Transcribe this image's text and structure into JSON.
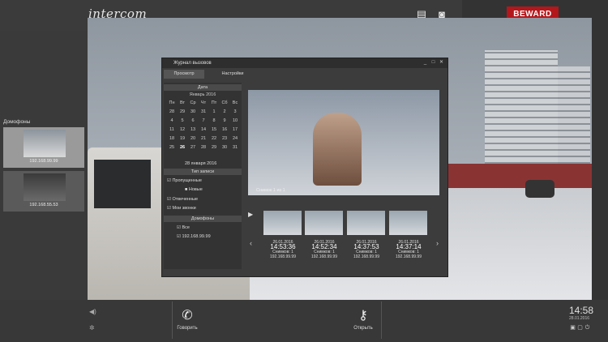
{
  "app": {
    "logo": "intercom",
    "brand": "BEWARD"
  },
  "sidebar": {
    "title": "Домофоны",
    "cameras": [
      {
        "ip": "192.168.99.99"
      },
      {
        "ip": "192.168.55.53"
      }
    ]
  },
  "dialog": {
    "title": "Журнал вызовов",
    "tabs": [
      "Просмотр",
      "Настройки"
    ],
    "date_header": "Дата",
    "month": "Январь 2016",
    "weekdays": [
      "Пн",
      "Вт",
      "Ср",
      "Чт",
      "Пт",
      "Сб",
      "Вс"
    ],
    "days": [
      [
        "28",
        "29",
        "30",
        "31",
        "1",
        "2",
        "3"
      ],
      [
        "4",
        "5",
        "6",
        "7",
        "8",
        "9",
        "10"
      ],
      [
        "11",
        "12",
        "13",
        "14",
        "15",
        "16",
        "17"
      ],
      [
        "18",
        "19",
        "20",
        "21",
        "22",
        "23",
        "24"
      ],
      [
        "25",
        "26",
        "27",
        "28",
        "29",
        "30",
        "31"
      ]
    ],
    "selected_date": "28 января 2016",
    "type_header": "Тип записи",
    "types": [
      "Пропущенные",
      "Новые",
      "Отвеченные",
      "Мои звонки"
    ],
    "intercom_header": "Домофоны",
    "intercoms": [
      "Все",
      "192.168.99.99"
    ],
    "preview_label": "Снимок 1 из 1",
    "snapshots": [
      {
        "date": "26.01.2016",
        "time": "14:53:36",
        "count": "Снимков: 1",
        "ip": "192.168.99.99"
      },
      {
        "date": "26.01.2016",
        "time": "14:52:34",
        "count": "Снимков: 1",
        "ip": "192.168.99.99"
      },
      {
        "date": "26.01.2016",
        "time": "14:37:53",
        "count": "Снимков: 1",
        "ip": "192.168.99.99"
      },
      {
        "date": "26.01.2016",
        "time": "14:37:14",
        "count": "Снимков: 1",
        "ip": "192.168.99.99"
      }
    ]
  },
  "controls": {
    "talk": "Говорить",
    "open": "Открыть"
  },
  "clock": {
    "time": "14:58",
    "date": "28.01.2016"
  }
}
